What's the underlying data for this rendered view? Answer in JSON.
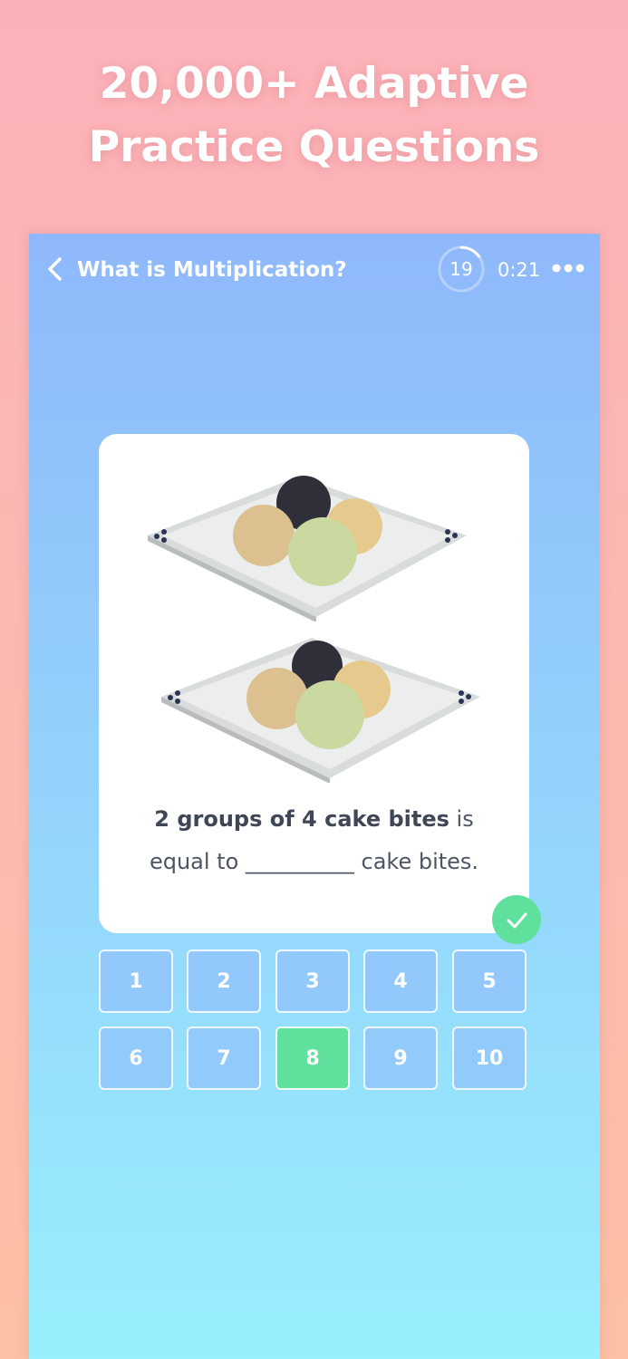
{
  "promo": {
    "headline_line1": "20,000+ Adaptive",
    "headline_line2": "Practice Questions"
  },
  "header": {
    "title": "What is Multiplication?",
    "question_counter": "19",
    "counter_progress": 0.15,
    "timer": "0:21"
  },
  "question": {
    "bold_text": "2 groups of 4 cake bites",
    "text_after_bold": " is",
    "line2_prefix": "equal to ",
    "blank": "__________",
    "line2_suffix": " cake bites."
  },
  "answers": {
    "options": [
      "1",
      "2",
      "3",
      "4",
      "5",
      "6",
      "7",
      "8",
      "9",
      "10"
    ],
    "selected": "8"
  },
  "colors": {
    "correct": "#5fe09d",
    "accent_blue": "#8fb8fb"
  },
  "icons": [
    "back-chevron-icon",
    "more-dots-icon",
    "checkmark-icon",
    "progress-ring-icon"
  ]
}
